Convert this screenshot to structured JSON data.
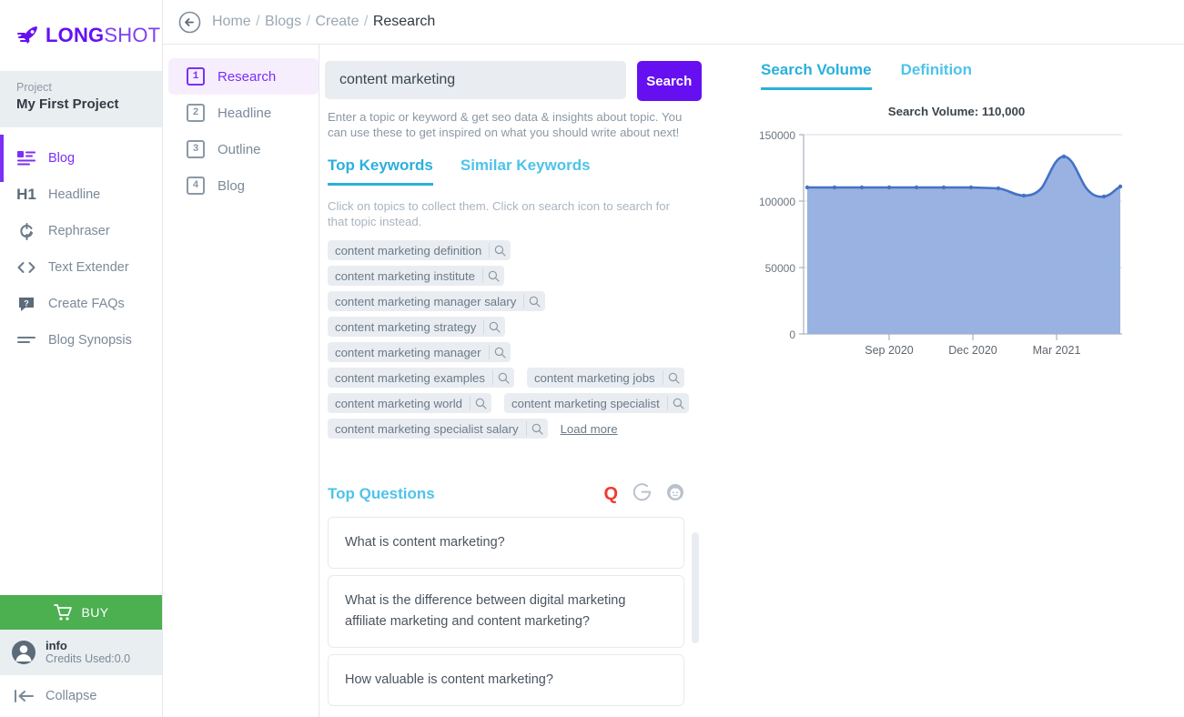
{
  "brand": {
    "name_bold": "LONG",
    "name_light": "SHOT"
  },
  "sidebar": {
    "project_label": "Project",
    "project_name": "My First Project",
    "items": [
      {
        "label": "Blog",
        "icon": "blog-icon",
        "active": true
      },
      {
        "label": "Headline",
        "icon": "h1-icon",
        "active": false
      },
      {
        "label": "Rephraser",
        "icon": "refresh-icon",
        "active": false
      },
      {
        "label": "Text Extender",
        "icon": "code-brackets-icon",
        "active": false
      },
      {
        "label": "Create FAQs",
        "icon": "question-bubble-icon",
        "active": false
      },
      {
        "label": "Blog Synopsis",
        "icon": "lines-icon",
        "active": false
      }
    ],
    "buy_label": "BUY",
    "account_name": "info",
    "account_credits": "Credits Used:0.0",
    "collapse_label": "Collapse"
  },
  "breadcrumb": {
    "items": [
      "Home",
      "Blogs",
      "Create"
    ],
    "current": "Research",
    "separator": "/"
  },
  "steps": [
    {
      "num": "1",
      "label": "Research",
      "active": true
    },
    {
      "num": "2",
      "label": "Headline",
      "active": false
    },
    {
      "num": "3",
      "label": "Outline",
      "active": false
    },
    {
      "num": "4",
      "label": "Blog",
      "active": false
    }
  ],
  "search": {
    "value": "content marketing",
    "placeholder": "Enter a topic or keyword",
    "button_label": "Search",
    "hint": "Enter a topic or keyword & get seo data & insights about topic. You can use these to get inspired on what you should write about next!"
  },
  "keyword_tabs": [
    {
      "label": "Top Keywords",
      "active": true
    },
    {
      "label": "Similar Keywords",
      "active": false
    }
  ],
  "keywords_hint": "Click on topics to collect them. Click on search icon to search for that topic instead.",
  "keywords": [
    "content marketing definition",
    "content marketing institute",
    "content marketing manager salary",
    "content marketing strategy",
    "content marketing manager",
    "content marketing examples",
    "content marketing jobs",
    "content marketing world",
    "content marketing specialist",
    "content marketing specialist salary"
  ],
  "load_more_label": "Load more",
  "top_questions": {
    "title": "Top Questions",
    "sources": [
      {
        "name": "quora-icon",
        "label": "Q"
      },
      {
        "name": "google-icon",
        "label": "G"
      },
      {
        "name": "reddit-icon",
        "label": ""
      }
    ],
    "items": [
      "What is content marketing?",
      "What is the difference between digital marketing affiliate marketing and content marketing?",
      "How valuable is content marketing?"
    ]
  },
  "right_tabs": [
    {
      "label": "Search Volume",
      "active": true
    },
    {
      "label": "Definition",
      "active": false
    }
  ],
  "colors": {
    "brand_purple": "#6610f2",
    "accent_cyan": "#2ab0dd",
    "buy_green": "#4caf50",
    "chart_line": "#4472c4",
    "chart_fill": "#93aee0",
    "quora_red": "#f23a2e"
  },
  "chart_data": {
    "type": "area",
    "title": "Search Volume: 110,000",
    "xlabel": "",
    "ylabel": "",
    "ylim": [
      0,
      150000
    ],
    "yticks": [
      0,
      50000,
      100000,
      150000
    ],
    "ytick_labels": [
      "0",
      "50000",
      "100000",
      "150000"
    ],
    "xtick_labels": [
      "Sep 2020",
      "Dec 2020",
      "Mar 2021"
    ],
    "grid": true,
    "legend": "none",
    "x": [
      "Jun 2020",
      "Jul 2020",
      "Aug 2020",
      "Sep 2020",
      "Oct 2020",
      "Nov 2020",
      "Dec 2020",
      "Jan 2021",
      "Feb 2021",
      "Mar 2021",
      "Apr 2021",
      "May 2021"
    ],
    "values": [
      110000,
      110000,
      110000,
      110000,
      110000,
      110000,
      110000,
      110000,
      105000,
      135000,
      104000,
      110000
    ],
    "series": [
      {
        "name": "Search Volume",
        "values": [
          110000,
          110000,
          110000,
          110000,
          110000,
          110000,
          110000,
          110000,
          105000,
          135000,
          104000,
          110000
        ]
      }
    ]
  }
}
